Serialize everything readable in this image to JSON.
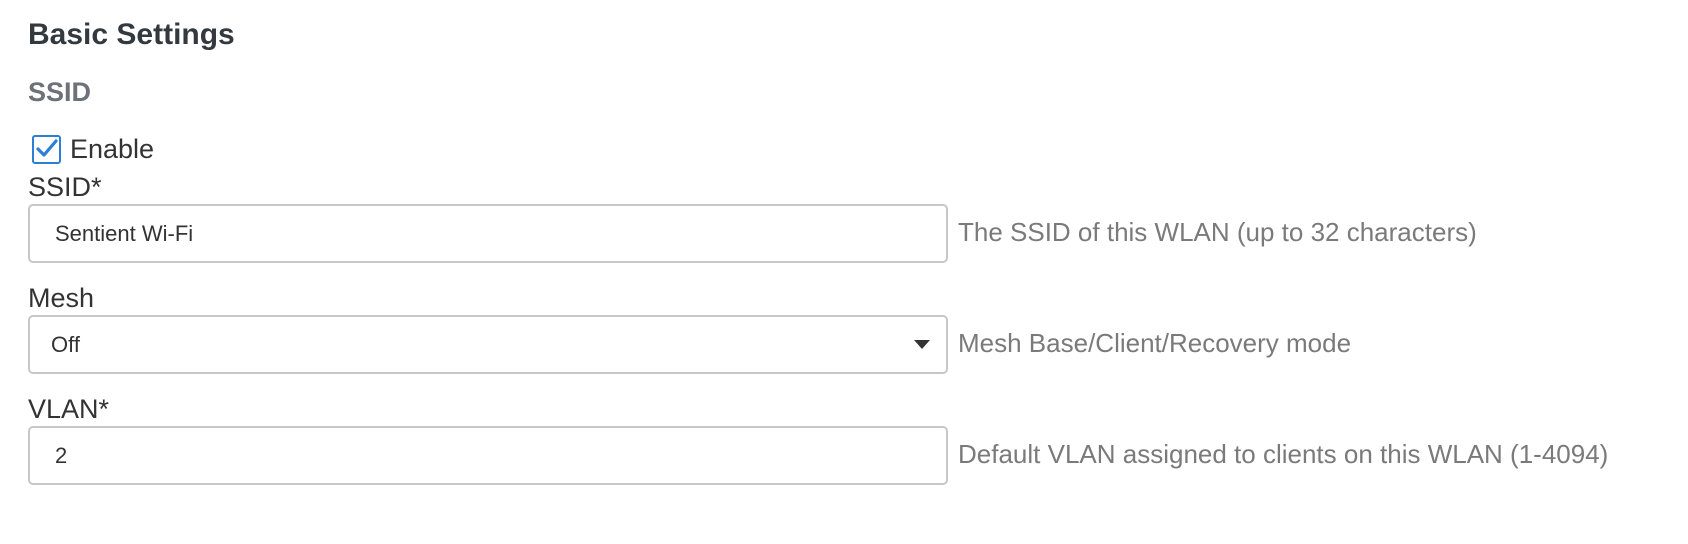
{
  "section_title": "Basic Settings",
  "ssid_section": {
    "title": "SSID",
    "enable": {
      "label": "Enable",
      "checked": true
    },
    "ssid_field": {
      "label": "SSID*",
      "value": "Sentient Wi-Fi",
      "help": "The SSID of this WLAN (up to 32 characters)"
    },
    "mesh_field": {
      "label": "Mesh",
      "selected": "Off",
      "help": "Mesh Base/Client/Recovery mode"
    },
    "vlan_field": {
      "label": "VLAN*",
      "value": "2",
      "help": "Default VLAN assigned to clients on this WLAN (1-4094)"
    }
  },
  "colors": {
    "checkbox_accent": "#2b7fd4",
    "field_border": "#c7c7c7",
    "help_text": "#7a7a7a",
    "subsection_title": "#6b7279"
  },
  "icons": {
    "checkbox_mark": "checkmark-icon",
    "select_caret": "caret-down-icon"
  }
}
